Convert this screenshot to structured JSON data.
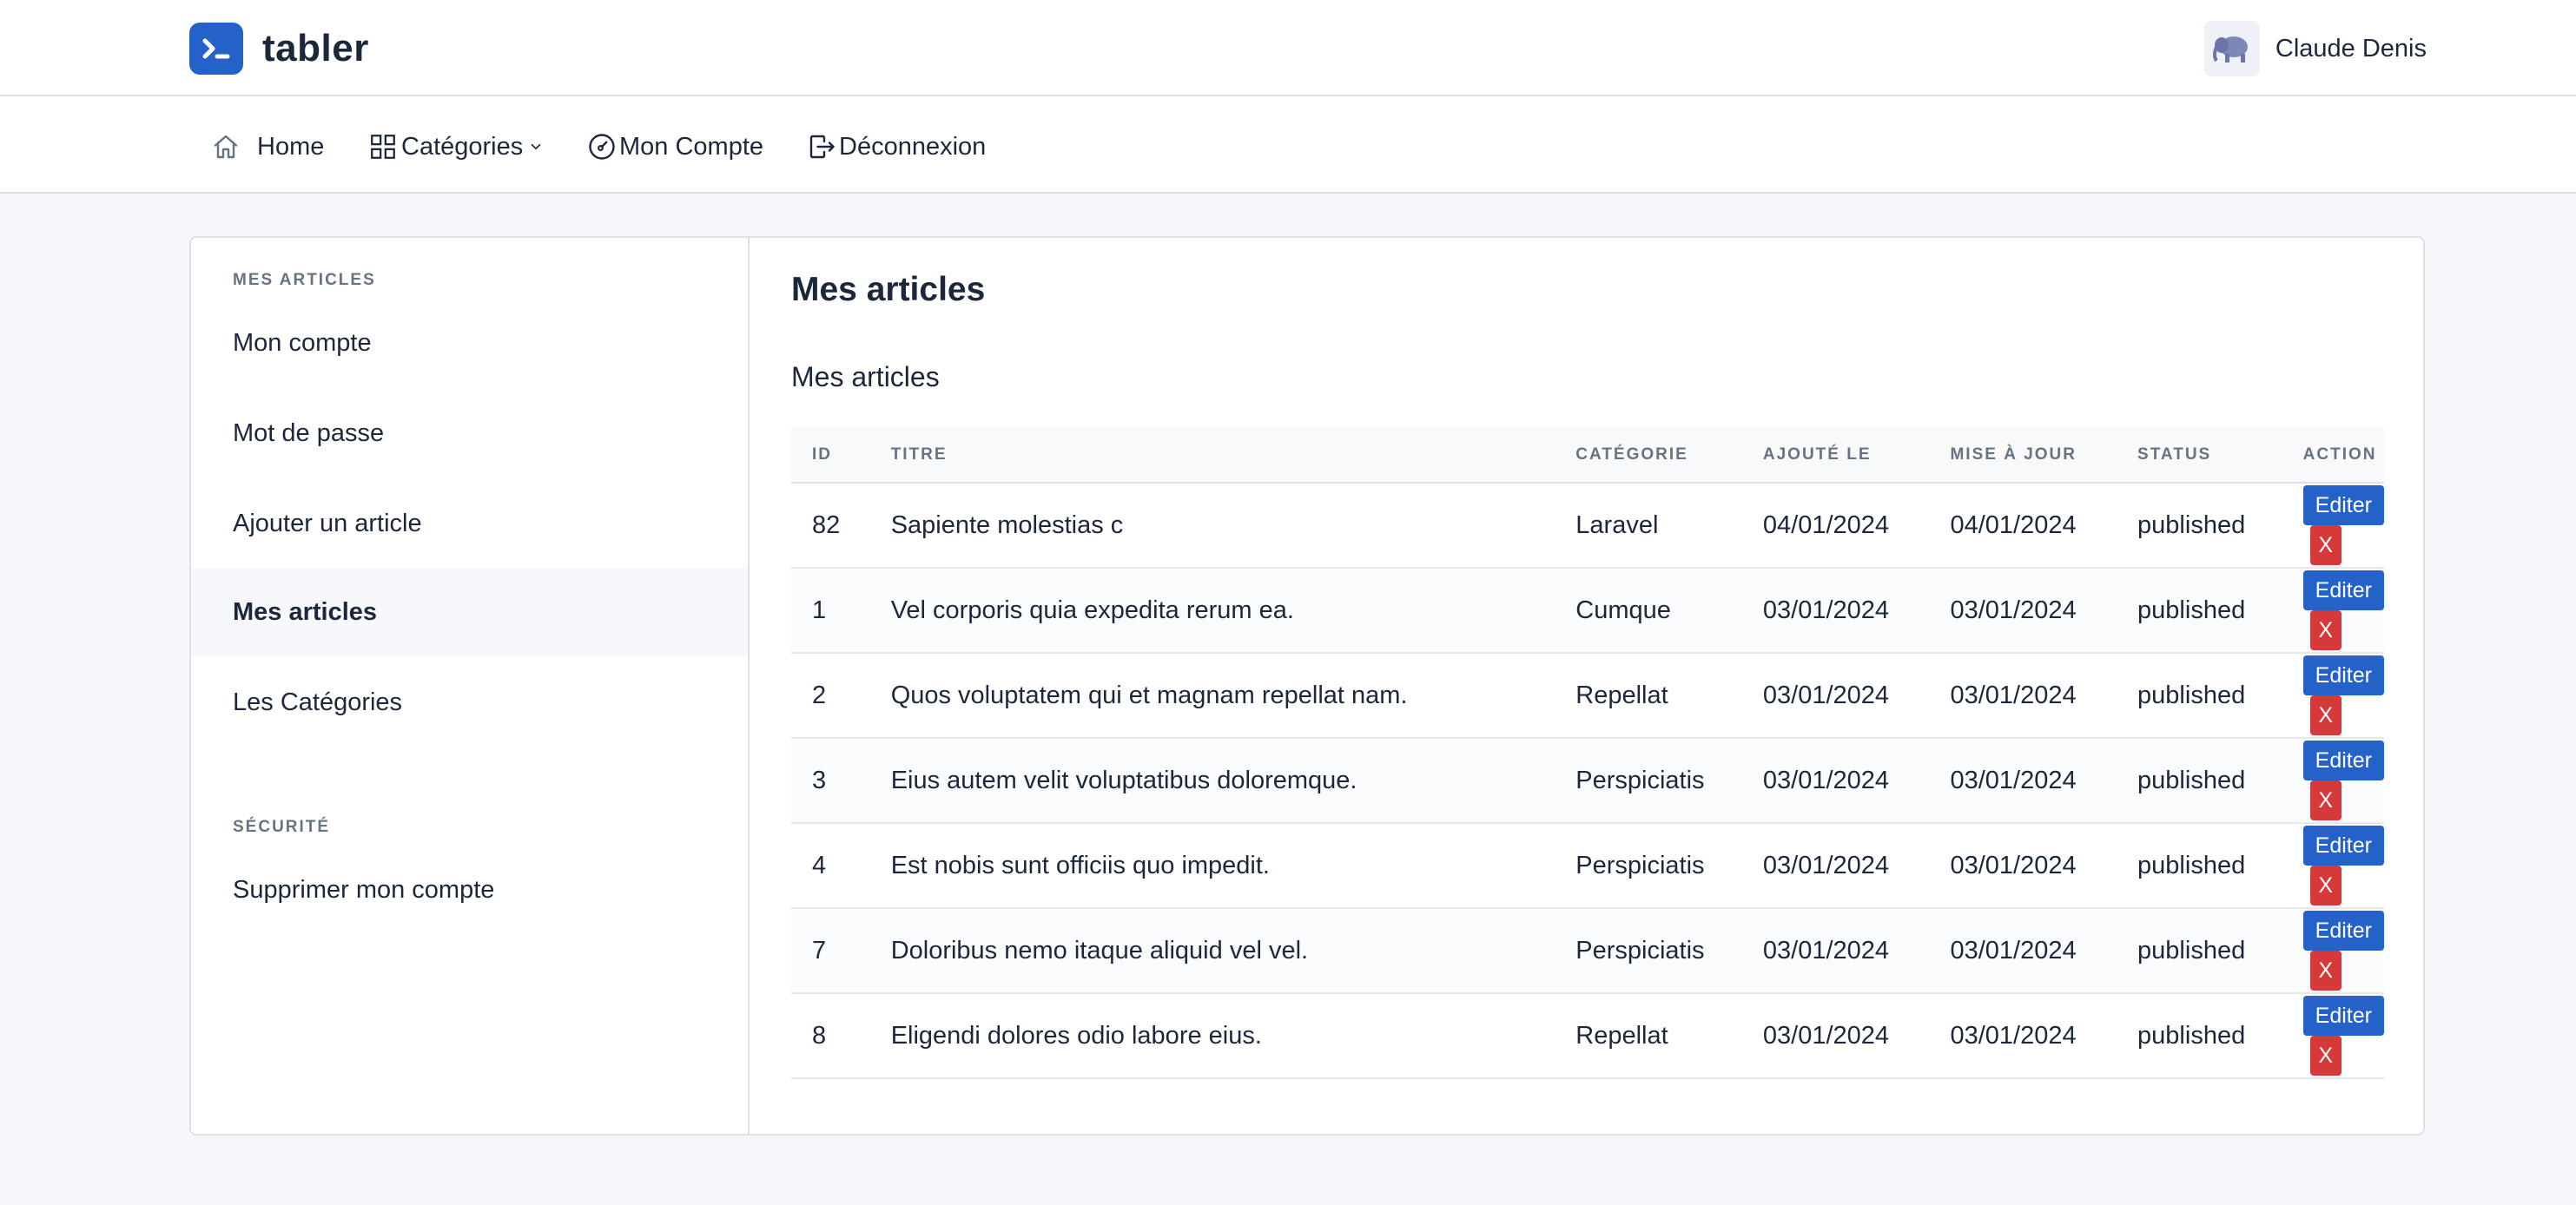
{
  "app": {
    "logo_text": "tabler"
  },
  "user": {
    "name": "Claude Denis"
  },
  "nav": {
    "home": "Home",
    "categories": "Catégories",
    "account": "Mon Compte",
    "logout": "Déconnexion"
  },
  "sidebar": {
    "section1": "MES ARTICLES",
    "items": [
      "Mon compte",
      "Mot de passe",
      "Ajouter un article",
      "Mes articles",
      "Les Catégories"
    ],
    "section2": "SÉCURITÉ",
    "security_items": [
      "Supprimer mon compte"
    ]
  },
  "main": {
    "title": "Mes articles",
    "subtitle": "Mes articles",
    "columns": [
      "ID",
      "TITRE",
      "CATÉGORIE",
      "AJOUTÉ LE",
      "MISE À JOUR",
      "STATUS",
      "ACTION"
    ],
    "edit_label": "Editer",
    "delete_label": "X",
    "rows": [
      {
        "id": "82",
        "title": "Sapiente molestias c",
        "category": "Laravel",
        "added": "04/01/2024",
        "updated": "04/01/2024",
        "status": "published"
      },
      {
        "id": "1",
        "title": "Vel corporis quia expedita rerum ea.",
        "category": "Cumque",
        "added": "03/01/2024",
        "updated": "03/01/2024",
        "status": "published"
      },
      {
        "id": "2",
        "title": "Quos voluptatem qui et magnam repellat nam.",
        "category": "Repellat",
        "added": "03/01/2024",
        "updated": "03/01/2024",
        "status": "published"
      },
      {
        "id": "3",
        "title": "Eius autem velit voluptatibus doloremque.",
        "category": "Perspiciatis",
        "added": "03/01/2024",
        "updated": "03/01/2024",
        "status": "published"
      },
      {
        "id": "4",
        "title": "Est nobis sunt officiis quo impedit.",
        "category": "Perspiciatis",
        "added": "03/01/2024",
        "updated": "03/01/2024",
        "status": "published"
      },
      {
        "id": "7",
        "title": "Doloribus nemo itaque aliquid vel vel.",
        "category": "Perspiciatis",
        "added": "03/01/2024",
        "updated": "03/01/2024",
        "status": "published"
      },
      {
        "id": "8",
        "title": "Eligendi dolores odio labore eius.",
        "category": "Repellat",
        "added": "03/01/2024",
        "updated": "03/01/2024",
        "status": "published"
      }
    ]
  },
  "colors": {
    "primary": "#2462c9",
    "danger": "#d63939",
    "text": "#1d273b",
    "muted": "#667382"
  }
}
